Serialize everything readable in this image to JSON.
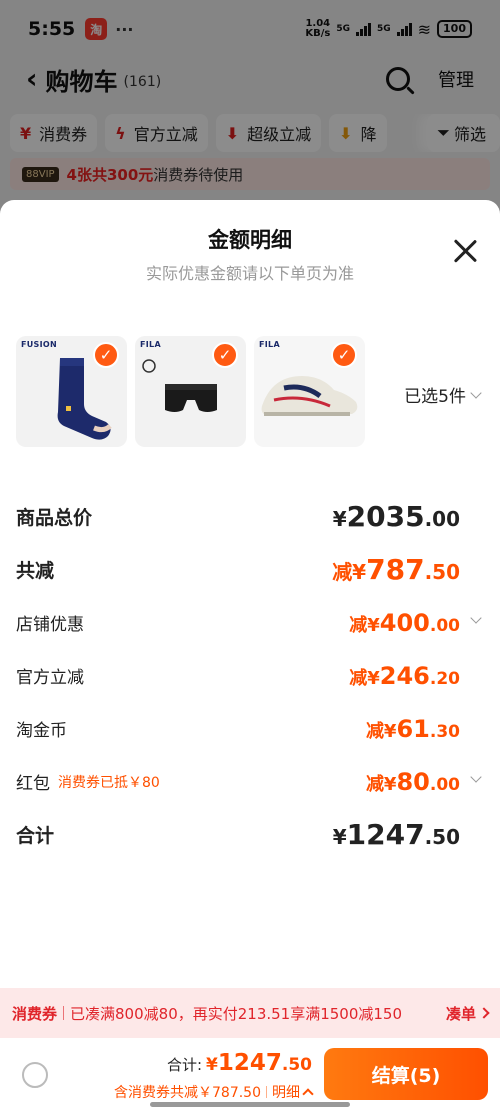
{
  "status_bar": {
    "time": "5:55",
    "app_icon_text": "淘",
    "more": "···",
    "speed_value": "1.04",
    "speed_unit": "KB/s",
    "net1": "5G",
    "net2": "5G",
    "battery": "100"
  },
  "header": {
    "title": "购物车",
    "count": "(161)",
    "manage": "管理",
    "filters": [
      {
        "icon": "voucher-icon",
        "label": "消费券"
      },
      {
        "icon": "lightning-icon",
        "label": "官方立减"
      },
      {
        "icon": "arrow-down-icon",
        "label": "超级立减"
      },
      {
        "icon": "arrow-down-icon",
        "label": "降"
      }
    ],
    "filter_label": "筛选"
  },
  "vip_bar": {
    "badge": "88VIP",
    "strong": "4张共300元",
    "rest": "消费券待使用"
  },
  "sheet": {
    "title": "金额明细",
    "subtitle": "实际优惠金额请以下单页为准",
    "products": [
      {
        "brand": "FUSION",
        "name": "socks"
      },
      {
        "brand": "FILA",
        "name": "boxer briefs"
      },
      {
        "brand": "FILA",
        "name": "sneaker"
      }
    ],
    "selected_text": "已选5件",
    "rows": [
      {
        "label": "商品总价",
        "prefix": "¥",
        "int": "2035",
        "dec": ".00"
      },
      {
        "label": "共减",
        "prefix": "减¥",
        "int": "787",
        "dec": ".50"
      },
      {
        "label": "店铺优惠",
        "prefix": "减¥",
        "int": "400",
        "dec": ".00"
      },
      {
        "label": "官方立减",
        "prefix": "减¥",
        "int": "246",
        "dec": ".20"
      },
      {
        "label": "淘金币",
        "prefix": "减¥",
        "int": "61",
        "dec": ".30"
      },
      {
        "label": "红包",
        "note": "消费券已抵￥80",
        "prefix": "减¥",
        "int": "80",
        "dec": ".00"
      },
      {
        "label": "合计",
        "prefix": "¥",
        "int": "1247",
        "dec": ".50"
      }
    ]
  },
  "coupon_bar": {
    "tag": "消费券",
    "message": "已凑满800减80，再实付213.51享满1500减150",
    "link": "凑单"
  },
  "bottom_bar": {
    "total_label": "合计:",
    "total_prefix": "¥",
    "total_int": "1247",
    "total_dec": ".50",
    "discount_text": "含消费券共减￥787.50",
    "details": "明细",
    "checkout": "结算(5)"
  },
  "colors": {
    "accent": "#ff5000",
    "coupon_red": "#e0252b",
    "check_orange": "#ff5a12"
  }
}
